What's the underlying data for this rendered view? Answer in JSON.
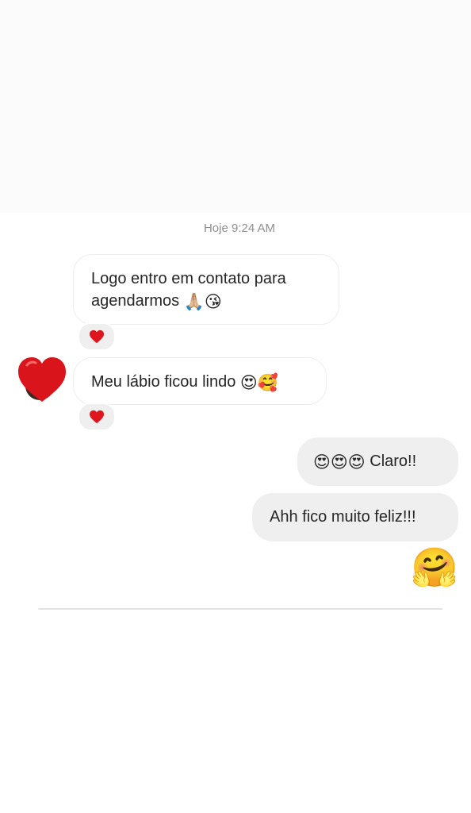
{
  "conversation": {
    "timestamp": "Hoje 9:24 AM",
    "messages": [
      {
        "direction": "received",
        "text": "Logo entro em contato para agendarmos",
        "emojis": "🙏🏼😘",
        "reaction": "heart-icon"
      },
      {
        "direction": "received",
        "text": "Meu lábio ficou lindo",
        "emojis": "😍🥰",
        "reaction": "heart-icon"
      },
      {
        "direction": "sent",
        "emojis": "😍😍😍",
        "text": "Claro!!"
      },
      {
        "direction": "sent",
        "text": "Ahh fico muito feliz!!!"
      },
      {
        "direction": "sent",
        "emojis": "🤗"
      }
    ]
  },
  "colors": {
    "heart": "#e0161e",
    "sent_bubble": "#efefef",
    "timestamp_text": "#8e8e8e"
  }
}
